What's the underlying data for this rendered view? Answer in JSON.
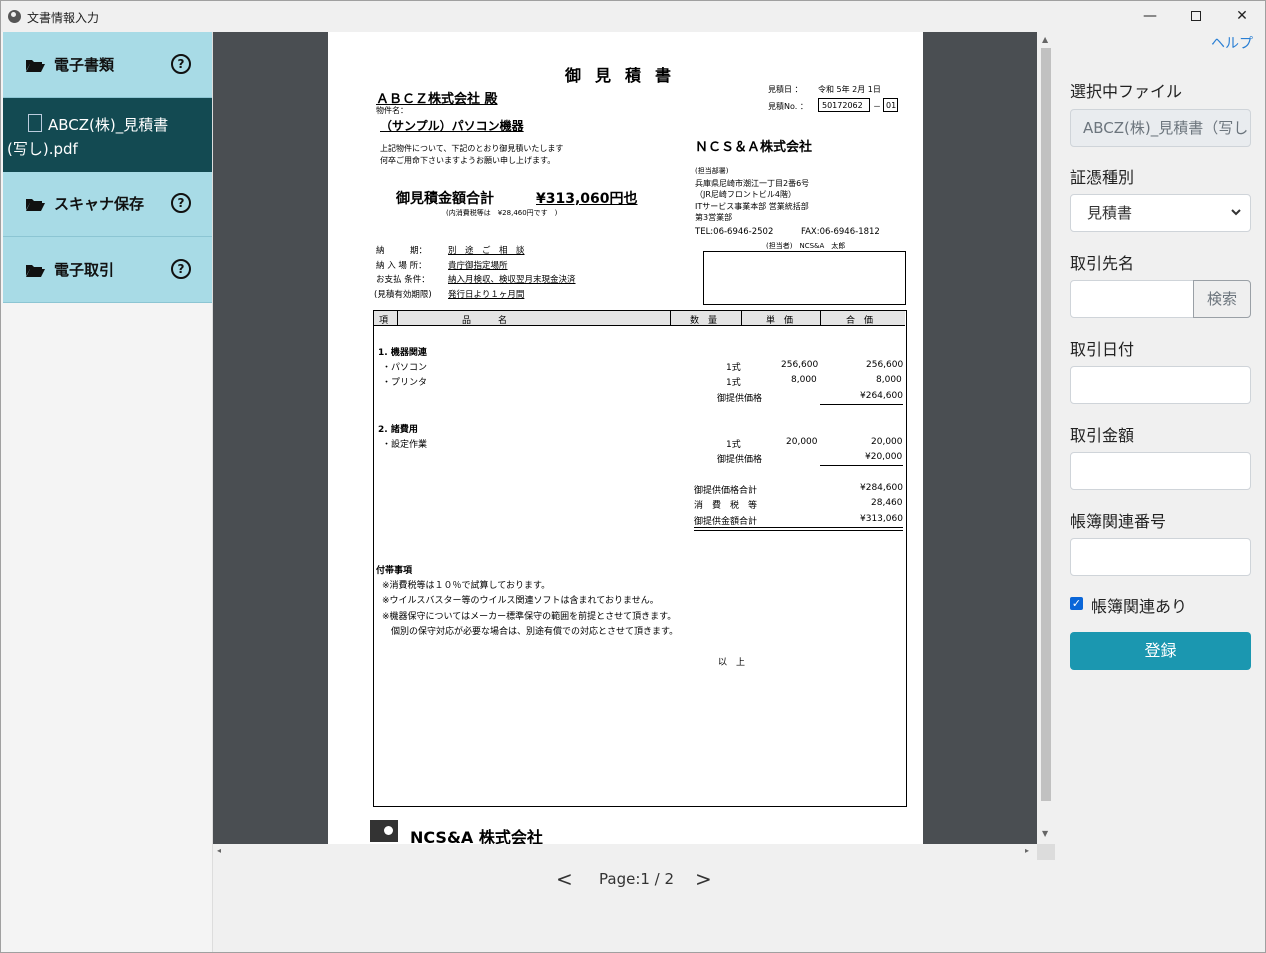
{
  "window": {
    "title": "文書情報入力",
    "close": "✕",
    "minimize": "—"
  },
  "sidebar": {
    "items": [
      {
        "label": "電子書類",
        "help": "?"
      },
      {
        "label": "スキャナ保存",
        "help": "?"
      },
      {
        "label": "電子取引",
        "help": "?"
      }
    ],
    "selected_file": {
      "line1": "ABCZ(株)_見積書",
      "line2": "(写し).pdf"
    }
  },
  "viewer": {
    "prev": "<",
    "page_info": "Page:1 / 2",
    "next": ">",
    "scroll_up": "▲",
    "scroll_down": "▼",
    "scroll_left": "◂",
    "scroll_right": "▸"
  },
  "document": {
    "title": "御見積書",
    "customer": "ＡＢＣＺ株式会社 殿",
    "subject_label": "物件名：",
    "subject": "（サンプル）パソコン機器",
    "date_label": "見積日 ：",
    "date": "令和 5年 2月 1日",
    "number_label": "見積No. ：",
    "number": "50172062",
    "number_dash": "－",
    "number_suffix": "01",
    "intro1": "上記物件について、下記のとおり御見積いたします",
    "intro2": "何卒ご用命下さいますようお願い申し上げます。",
    "company": "ＮＣＳ＆Ａ株式会社",
    "dept_label": "(担当部署)",
    "address1": "兵庫県尼崎市潮江一丁目2番6号",
    "address2": "（JR尼崎フロントビル4階）",
    "division1": "ITサービス事業本部 営業統括部",
    "division2": "第3営業部",
    "tel": "TEL:06-6946-2502",
    "fax": "FAX:06-6946-1812",
    "person": "(担当者)　NCS&A　太郎",
    "total_label": "御見積金額合計",
    "total_value": "¥313,060円也",
    "tax_note": "(内消費税等は　¥28,460円です　)",
    "delivery_label": "納　　　期：",
    "delivery": "別　途　ご　相　談",
    "place_label": "納 入 場 所：",
    "place": "貴庁御指定場所",
    "payment_label": "お支払 条件：",
    "payment": "納入月検収、検収翌月末現金決済",
    "validity_label": "(見積有効期限)",
    "validity": "発行日より１ヶ月間",
    "columns": [
      "項",
      "品　　　名",
      "数　量",
      "単　価",
      "合　価"
    ],
    "section1": "1. 機器関連",
    "items1": [
      {
        "name": "・パソコン",
        "qty": "1式",
        "unit": "256,600",
        "amount": "256,600"
      },
      {
        "name": "・プリンタ",
        "qty": "1式",
        "unit": "8,000",
        "amount": "8,000"
      }
    ],
    "subtotal_label": "御提供価格",
    "subtotal1": "¥264,600",
    "section2": "2. 諸費用",
    "items2": [
      {
        "name": "・設定作業",
        "qty": "1式",
        "unit": "20,000",
        "amount": "20,000"
      }
    ],
    "subtotal2": "¥20,000",
    "sum_label1": "御提供価格合計",
    "sum_value1": "¥284,600",
    "sum_label2": "消　費　税　等",
    "sum_value2": "28,460",
    "sum_label3": "御提供金額合計",
    "sum_value3": "¥313,060",
    "notes_title": "付帯事項",
    "notes": [
      "※消費税等は１０％で試算しております。",
      "※ウイルスバスター等のウイルス関連ソフトは含まれておりません。",
      "※機器保守についてはメーカー標準保守の範囲を前提とさせて頂きます。",
      "　個別の保守対応が必要な場合は、別途有償での対応とさせて頂きます。"
    ],
    "end": "以　上",
    "footer_logo": "NCS&A 株式会社"
  },
  "form": {
    "help_link": "ヘルプ",
    "file_label": "選択中ファイル",
    "file_value": "ABCZ(株)_見積書（写し",
    "type_label": "証憑種別",
    "type_value": "見積書",
    "partner_label": "取引先名",
    "search_button": "検索",
    "date_label": "取引日付",
    "amount_label": "取引金額",
    "ledger_label": "帳簿関連番号",
    "checkbox_mark": "✓",
    "checkbox_label": "帳簿関連あり",
    "submit_label": "登録"
  }
}
